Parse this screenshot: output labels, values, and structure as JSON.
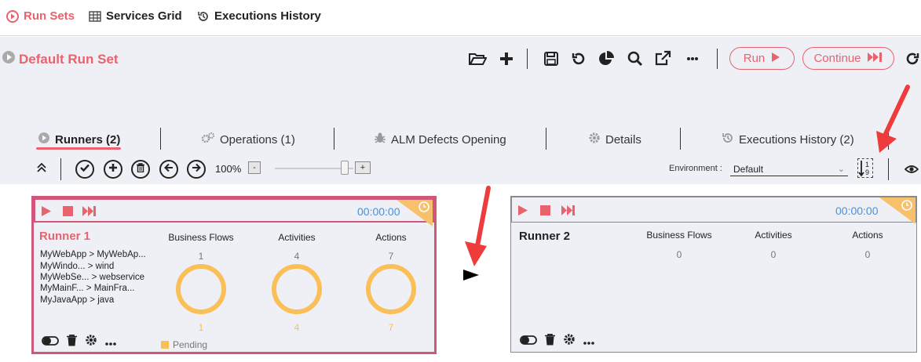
{
  "nav": {
    "run_sets": "Run Sets",
    "services_grid": "Services Grid",
    "executions_history": "Executions History"
  },
  "runset": {
    "title": "Default Run Set",
    "run_label": "Run",
    "continue_label": "Continue"
  },
  "tabs": [
    {
      "label": "Runners (2)"
    },
    {
      "label": "Operations (1)"
    },
    {
      "label": "ALM Defects Opening"
    },
    {
      "label": "Details"
    },
    {
      "label": "Executions History (2)"
    }
  ],
  "toolbar": {
    "zoom": "100%",
    "zoom_minus": "-",
    "zoom_plus": "+",
    "zoom_level": 100,
    "environment_label": "Environment :",
    "environment_value": "Default"
  },
  "columns": {
    "business_flows": "Business Flows",
    "activities": "Activities",
    "actions": "Actions"
  },
  "runners": [
    {
      "name": "Runner 1",
      "time": "00:00:00",
      "flows": [
        "MyWebApp > MyWebAp...",
        "MyWindo... > wind",
        "MyWebSe... > webservice",
        "MyMainF... > MainFra...",
        "MyJavaApp > java"
      ],
      "business_flows": "1",
      "activities": "4",
      "actions": "7",
      "pending_business_flows": "1",
      "pending_activities": "4",
      "pending_actions": "7",
      "legend": "Pending"
    },
    {
      "name": "Runner 2",
      "time": "00:00:00",
      "business_flows": "0",
      "activities": "0",
      "actions": "0"
    }
  ],
  "colors": {
    "accent": "#e8636d",
    "pending": "#fbbf57",
    "time": "#4a90d9"
  }
}
